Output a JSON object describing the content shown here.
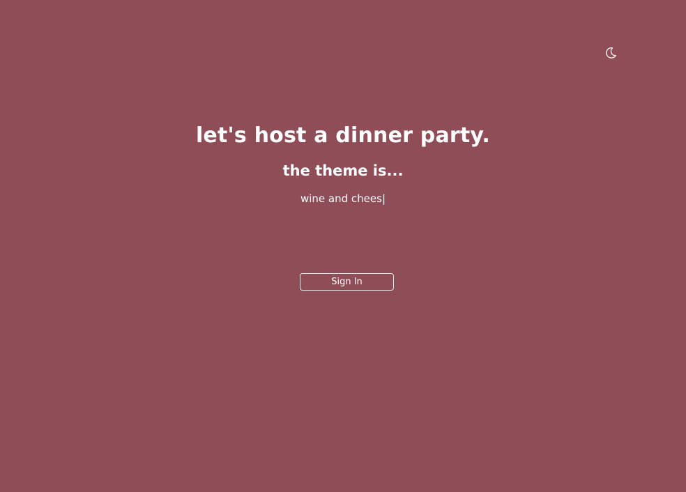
{
  "header": {
    "theme_toggle_icon": "crescent-moon-icon"
  },
  "hero": {
    "headline": "let's host a dinner party.",
    "subhead": "the theme is...",
    "typed_text": "wine and chees",
    "cursor": "|"
  },
  "actions": {
    "sign_in_label": "Sign In"
  },
  "colors": {
    "background": "#8f4d57",
    "text": "#ffffff"
  }
}
